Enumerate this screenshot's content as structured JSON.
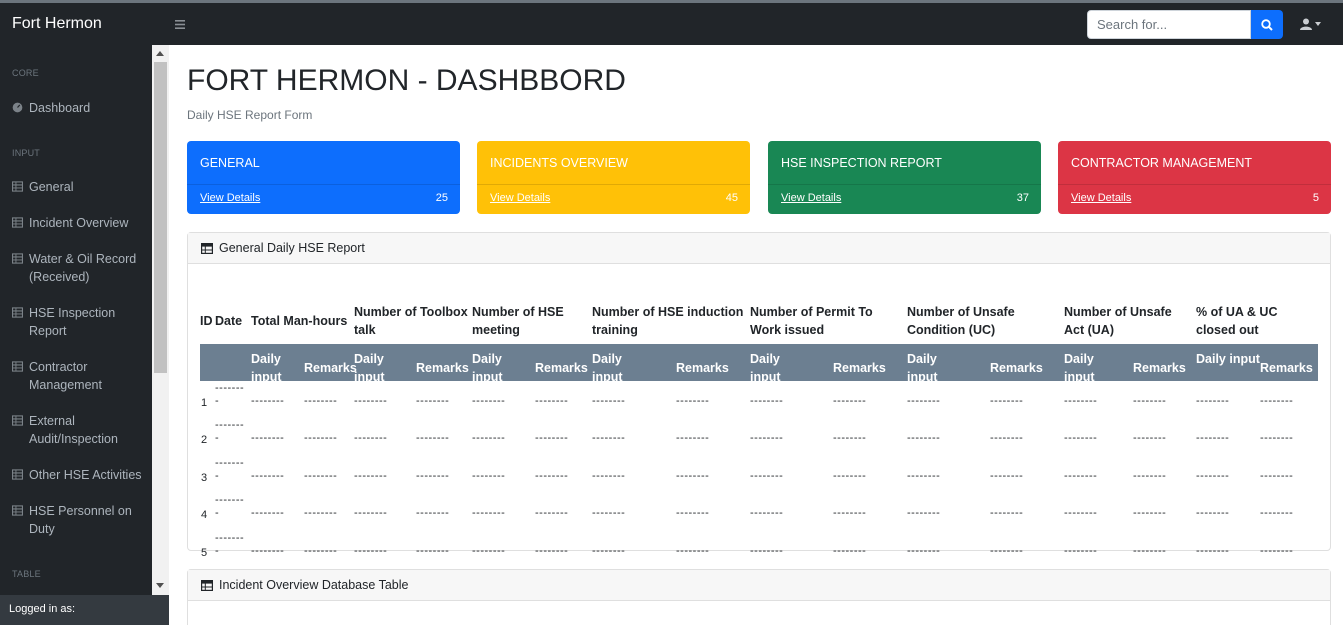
{
  "app": {
    "brand": "Fort Hermon"
  },
  "search": {
    "placeholder": "Search for..."
  },
  "sidebar": {
    "sections": {
      "core": "CORE",
      "input": "INPUT",
      "table": "TABLE"
    },
    "items": [
      {
        "label": "Dashboard",
        "icon": "gauge-icon"
      },
      {
        "label": "General",
        "icon": "table-icon"
      },
      {
        "label": "Incident Overview",
        "icon": "table-icon"
      },
      {
        "label": "Water & Oil Record (Received)",
        "icon": "table-icon"
      },
      {
        "label": "HSE Inspection Report",
        "icon": "table-icon"
      },
      {
        "label": "Contractor Management",
        "icon": "table-icon"
      },
      {
        "label": "External Audit/Inspection",
        "icon": "table-icon"
      },
      {
        "label": "Other HSE Activities",
        "icon": "table-icon"
      },
      {
        "label": "HSE Personnel on Duty",
        "icon": "table-icon"
      }
    ],
    "footer": "Logged in as:"
  },
  "page": {
    "title": "FORT HERMON - DASHBBORD",
    "subtitle": "Daily HSE Report Form"
  },
  "cards": [
    {
      "title": "GENERAL",
      "link": "View Details",
      "count": "25",
      "color": "#0d6efd"
    },
    {
      "title": "INCIDENTS OVERVIEW",
      "link": "View Details",
      "count": "45",
      "color": "#ffc107"
    },
    {
      "title": "HSE INSPECTION REPORT",
      "link": "View Details",
      "count": "37",
      "color": "#198754"
    },
    {
      "title": "CONTRACTOR MANAGEMENT",
      "link": "View Details",
      "count": "5",
      "color": "#dc3545"
    }
  ],
  "report": {
    "title": "General Daily HSE Report",
    "headers": [
      "ID",
      "Date",
      "Total Man-hours",
      "Number of Toolbox talk",
      "Number of HSE meeting",
      "Number of HSE induction training",
      "Number of Permit To Work issued",
      "Number of Unsafe Condition (UC)",
      "Number of Unsafe Act (UA)",
      "% of UA & UC closed out"
    ],
    "subheaders": [
      "Daily input",
      "Remarks"
    ],
    "rows": [
      "1",
      "2",
      "3",
      "4",
      "5"
    ],
    "placeholder": "--------",
    "date_placeholder": "-------\n-"
  },
  "incident_panel": {
    "title": "Incident Overview Database Table"
  },
  "colors": {
    "topbar": "#212529",
    "sidebar": "#212529",
    "subheader": "#6c7f91",
    "primary": "#0d6efd"
  }
}
